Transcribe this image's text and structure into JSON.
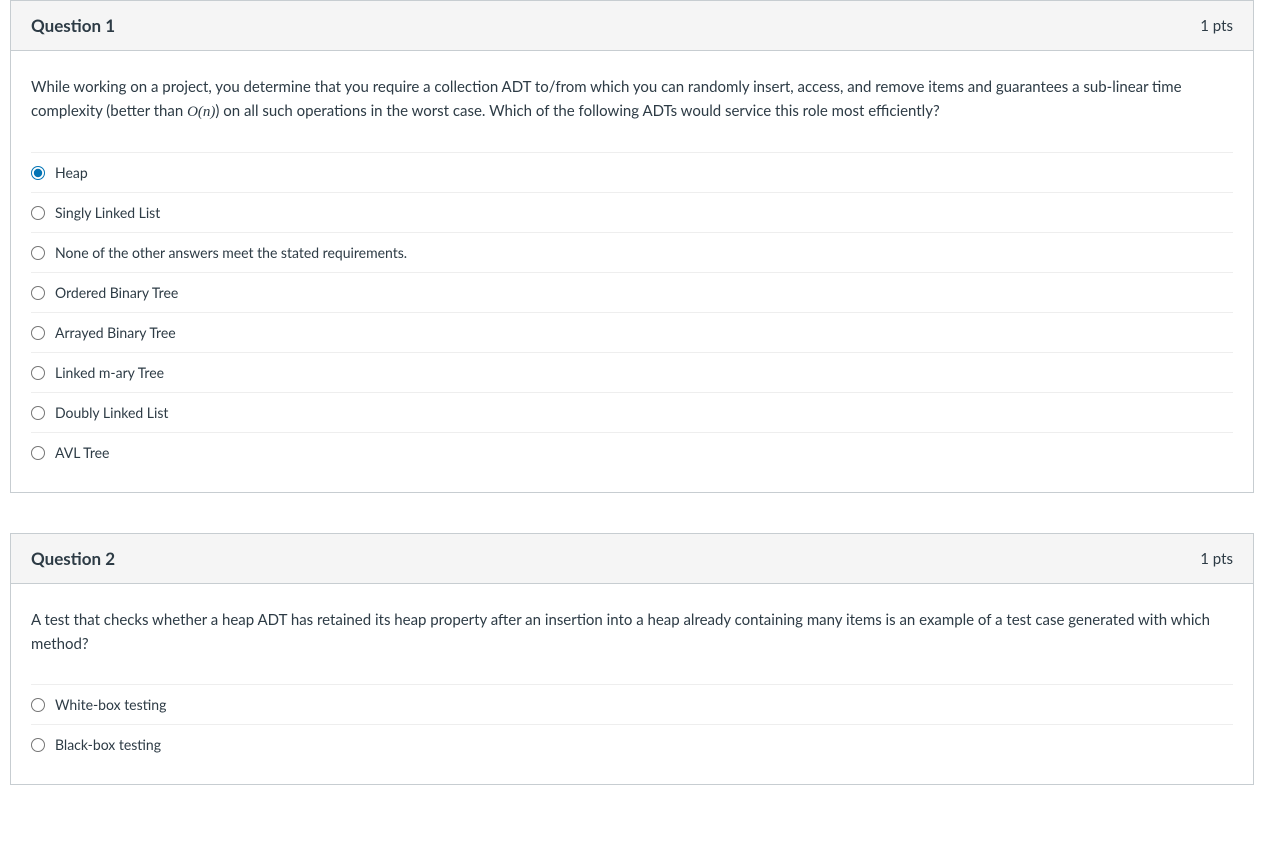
{
  "questions": [
    {
      "title": "Question 1",
      "points": "1 pts",
      "text_before": "While working on a project, you determine that you require a collection ADT to/from which you can randomly insert, access, and remove items and guarantees a sub-linear time complexity (better than ",
      "text_math": "O(n)",
      "text_after": ") on all such operations in the worst case.    Which of the following ADTs would service this role most efficiently?",
      "answers": [
        {
          "label": "Heap",
          "selected": true
        },
        {
          "label": "Singly Linked List",
          "selected": false
        },
        {
          "label": "None of the other answers meet the stated requirements.",
          "selected": false
        },
        {
          "label": "Ordered Binary Tree",
          "selected": false
        },
        {
          "label": "Arrayed Binary Tree",
          "selected": false
        },
        {
          "label": "Linked m-ary Tree",
          "selected": false
        },
        {
          "label": "Doubly Linked List",
          "selected": false
        },
        {
          "label": "AVL Tree",
          "selected": false
        }
      ]
    },
    {
      "title": "Question 2",
      "points": "1 pts",
      "text_before": "A test that checks whether a heap ADT has retained its heap property after an insertion into a heap already containing many items is an example of a test case generated with which method?",
      "text_math": "",
      "text_after": "",
      "answers": [
        {
          "label": "White-box testing",
          "selected": false
        },
        {
          "label": "Black-box testing",
          "selected": false
        }
      ]
    }
  ]
}
